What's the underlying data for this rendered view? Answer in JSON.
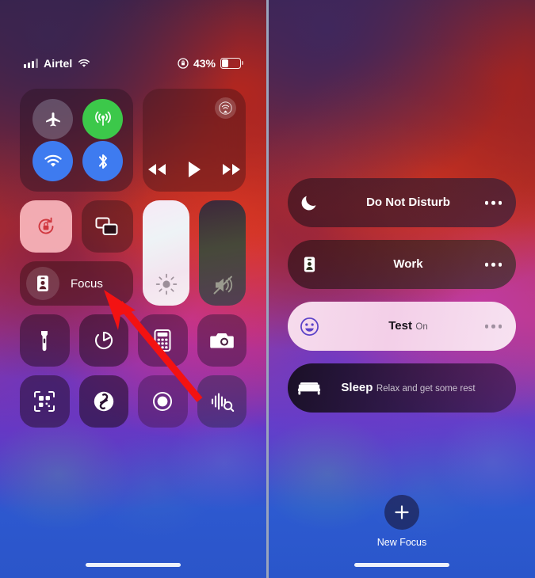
{
  "status_bar": {
    "carrier": "Airtel",
    "battery_percent": "43%",
    "signal_icon": "cellular-bars-icon",
    "wifi_icon": "wifi-icon",
    "rotation_lock_icon": "rotation-lock-icon",
    "battery_icon": "battery-icon"
  },
  "control_center": {
    "connectivity": {
      "airplane": {
        "name": "Airplane Mode",
        "icon": "airplane-icon",
        "state": "off",
        "color": "#bec3d7"
      },
      "cellular": {
        "name": "Cellular Data",
        "icon": "cellular-antenna-icon",
        "state": "on",
        "color": "#3cc84a"
      },
      "wifi": {
        "name": "Wi-Fi",
        "icon": "wifi-icon",
        "state": "on",
        "color": "#3e7bf0"
      },
      "bluetooth": {
        "name": "Bluetooth",
        "icon": "bluetooth-icon",
        "state": "on",
        "color": "#3e7bf0"
      }
    },
    "media": {
      "airplay_icon": "airplay-audio-icon",
      "rewind_icon": "rewind-icon",
      "play_icon": "play-icon",
      "forward_icon": "fast-forward-icon"
    },
    "rotation_lock": {
      "name": "Rotation Lock",
      "icon": "rotation-lock-icon",
      "state": "on"
    },
    "screen_mirroring": {
      "name": "Screen Mirroring",
      "icon": "screen-mirroring-icon",
      "state": "off"
    },
    "focus": {
      "label": "Focus",
      "icon": "focus-badge-icon"
    },
    "brightness": {
      "name": "Brightness",
      "icon": "brightness-sun-icon",
      "level": 92
    },
    "volume": {
      "name": "Volume",
      "icon": "volume-muted-icon",
      "level": 0
    },
    "tiles": [
      {
        "label": "Flashlight",
        "icon": "flashlight-icon"
      },
      {
        "label": "Timer",
        "icon": "timer-icon"
      },
      {
        "label": "Calculator",
        "icon": "calculator-icon"
      },
      {
        "label": "Camera",
        "icon": "camera-icon"
      },
      {
        "label": "Code Scanner",
        "icon": "qr-scanner-icon"
      },
      {
        "label": "Shazam",
        "icon": "shazam-icon"
      },
      {
        "label": "Screen Recording",
        "icon": "screen-record-icon"
      },
      {
        "label": "Sound Recognition",
        "icon": "sound-recognition-icon"
      }
    ]
  },
  "focus_panel": {
    "items": [
      {
        "title": "Do Not Disturb",
        "subtitle": "",
        "icon": "moon-icon",
        "active": false,
        "has_more": true
      },
      {
        "title": "Work",
        "subtitle": "",
        "icon": "work-badge-icon",
        "active": false,
        "has_more": true
      },
      {
        "title": "Test",
        "subtitle": "On",
        "icon": "smiley-face-icon",
        "active": true,
        "has_more": true
      },
      {
        "title": "Sleep",
        "subtitle": "Relax and get some rest",
        "icon": "bed-icon",
        "active": false,
        "has_more": false
      }
    ],
    "new_focus": {
      "label": "New Focus",
      "icon": "plus-icon"
    }
  },
  "annotation": {
    "arrow_color": "#f31212",
    "points_to": "Focus"
  }
}
